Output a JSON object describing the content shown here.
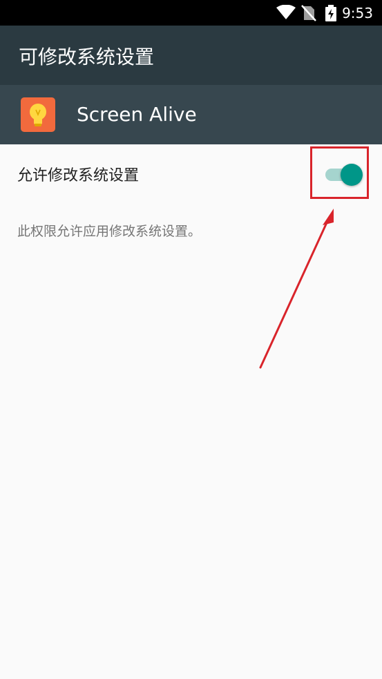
{
  "status_bar": {
    "time": "9:53",
    "icons": [
      "wifi-icon",
      "no-sim-icon",
      "battery-charging-icon"
    ]
  },
  "app_bar": {
    "title": "可修改系统设置"
  },
  "app_header": {
    "app_name": "Screen Alive",
    "app_icon": "lightbulb-icon"
  },
  "setting": {
    "label": "允许修改系统设置",
    "enabled": true,
    "description": "此权限允许应用修改系统设置。"
  },
  "annotation": {
    "highlight_color": "#d9242b"
  },
  "colors": {
    "toolbar": "#2b3a41",
    "header": "#37474f",
    "accent": "#009688"
  }
}
